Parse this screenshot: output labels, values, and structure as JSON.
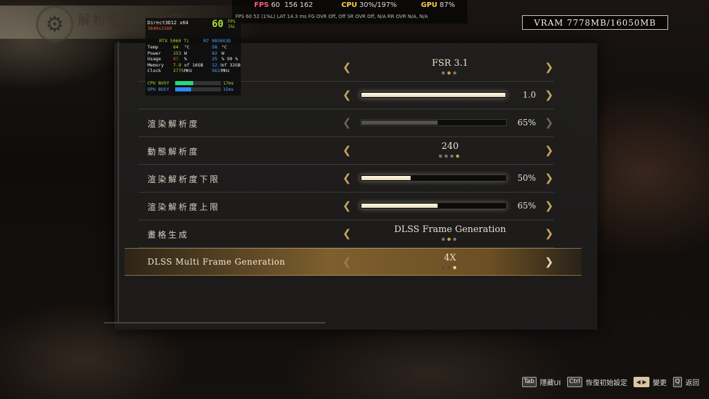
{
  "page": {
    "title": "解析度詳細設定",
    "emblem_icon": "gear-crest-icon"
  },
  "perf_top": {
    "fps_label": "FPS",
    "fps": "60",
    "fps_extra": "156 162",
    "cpu_label": "CPU",
    "cpu": "30%/197%",
    "gpu_label": "GPU",
    "gpu": "87%",
    "line2": "FPS  60  52 (1%L)    LAT 14.3 ms    FG OVR Off, Off    SR OVR Off, N/A    RR OVR N/A, N/A"
  },
  "vram": {
    "label": "VRAM 7778MB/16050MB"
  },
  "settings": [
    {
      "label": "",
      "type": "option",
      "value": "FSR 3.1",
      "dots": 3,
      "active_dot": 2
    },
    {
      "label": "",
      "type": "slider",
      "value": "1.0",
      "fraction": 1.0
    },
    {
      "label": "渲染解析度",
      "type": "slider",
      "value": "65%",
      "fraction": 0.53,
      "disabled": true
    },
    {
      "label": "動態解析度",
      "type": "option",
      "value": "240",
      "dots": 4,
      "active_dot": 4
    },
    {
      "label": "渲染解析度下限",
      "type": "slider",
      "value": "50%",
      "fraction": 0.34
    },
    {
      "label": "渲染解析度上限",
      "type": "slider",
      "value": "65%",
      "fraction": 0.53
    },
    {
      "label": "畫格生成",
      "type": "option",
      "value": "DLSS Frame Generation",
      "dots": 3,
      "active_dot": 2
    },
    {
      "label": "DLSS Multi Frame Generation",
      "type": "option",
      "value": "4X",
      "dots": 3,
      "active_dot": 3,
      "selected": true
    }
  ],
  "overlay": {
    "api": "Direct3D12 x64",
    "resolution": "3840x2160",
    "fps": "60",
    "fps_unit": "FPS",
    "fps_sub": "1%L",
    "gpu_name": "RTX 5060 Ti",
    "cpu_name": "R7 9850X3D",
    "rows": [
      {
        "k": "Temp",
        "g": "64",
        "gu": "°C",
        "c": "58",
        "cu": "°C"
      },
      {
        "k": "Power",
        "g": "153",
        "gu": "W",
        "c": "82",
        "cu": "W"
      },
      {
        "k": "Usage",
        "g": "87",
        "gu": "%",
        "c": "25",
        "cu": "% 99 %"
      },
      {
        "k": "Memory",
        "g": "7.9",
        "gu": "of 16GB",
        "c": "12.9",
        "cu": "of 32GB"
      },
      {
        "k": "Clock",
        "g": "2775",
        "gu": "MHz",
        "c": "5615",
        "cu": "MHz"
      }
    ],
    "cpu_busy_label": "CPU BUSY",
    "cpu_busy": "17ms",
    "cpu_busy_fraction": 0.4,
    "gpu_busy_label": "GPU BUSY",
    "gpu_busy": "15ms",
    "gpu_busy_fraction": 0.35,
    "colors": {
      "gpu": "#a6e22e",
      "cpu": "#5aa6ff",
      "cpu_busy_bar": "#2ad67a",
      "gpu_busy_bar": "#2f86ff"
    }
  },
  "hints": [
    {
      "key": "Tab",
      "label": "隱藏UI"
    },
    {
      "key": "Ctrl",
      "label": "恢復初始設定"
    },
    {
      "key": "◀ ▶",
      "label": "變更"
    },
    {
      "key": "Q",
      "label": "返回"
    }
  ],
  "colors": {
    "accent_gold": "#c8a35e",
    "selected_row": "#b98a3e",
    "slider_fill": "#f4ecd6"
  }
}
